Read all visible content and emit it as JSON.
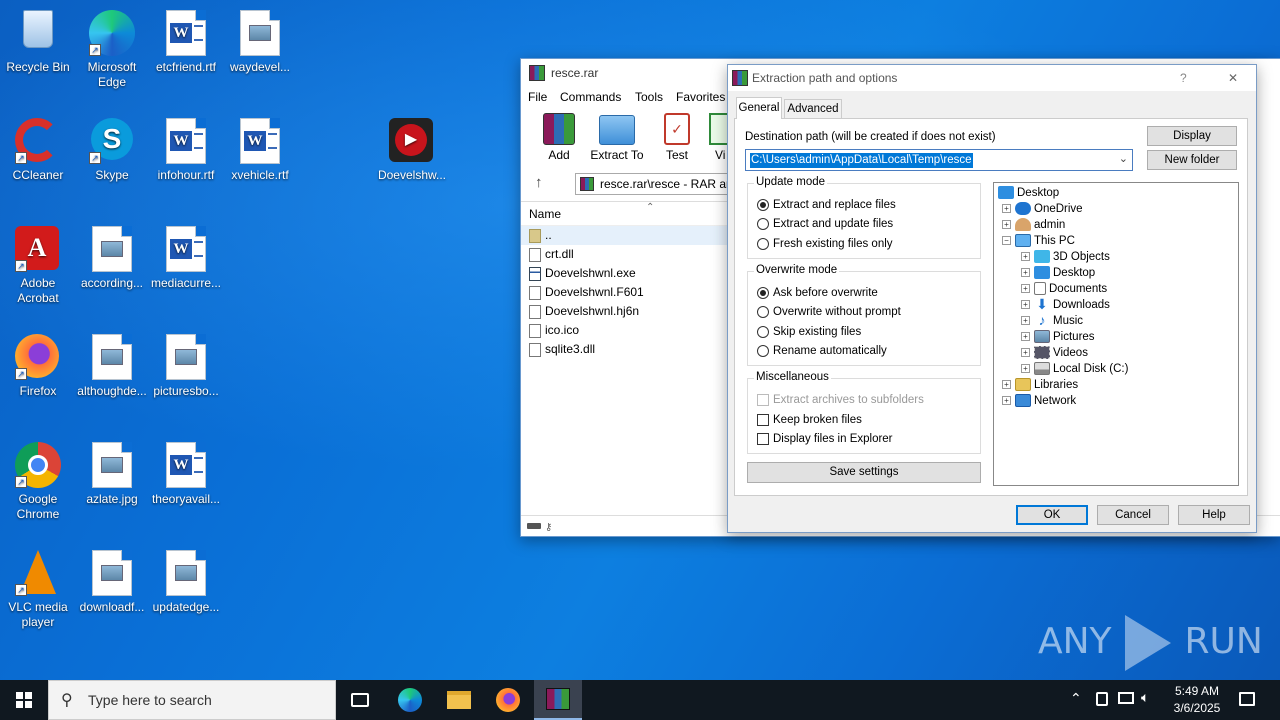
{
  "desktop": {
    "icons": [
      {
        "label": "Recycle Bin",
        "icon": "recycle-bin-icon"
      },
      {
        "label": "Microsoft Edge",
        "icon": "edge-icon"
      },
      {
        "label": "etcfriend.rtf",
        "icon": "word-doc-icon"
      },
      {
        "label": "waydevel...",
        "icon": "image-file-icon"
      },
      {
        "label": "CCleaner",
        "icon": "ccleaner-icon"
      },
      {
        "label": "Skype",
        "icon": "skype-icon"
      },
      {
        "label": "infohour.rtf",
        "icon": "word-doc-icon"
      },
      {
        "label": "xvehicle.rtf",
        "icon": "word-doc-icon"
      },
      {
        "label": "Doevelshw...",
        "icon": "media-player-icon"
      },
      {
        "label": "Adobe Acrobat",
        "icon": "acrobat-icon"
      },
      {
        "label": "according...",
        "icon": "image-file-icon"
      },
      {
        "label": "mediacurre...",
        "icon": "word-doc-icon"
      },
      {
        "label": "Firefox",
        "icon": "firefox-icon"
      },
      {
        "label": "althoughde...",
        "icon": "image-file-icon"
      },
      {
        "label": "picturesbo...",
        "icon": "image-file-icon"
      },
      {
        "label": "Google Chrome",
        "icon": "chrome-icon"
      },
      {
        "label": "azlate.jpg",
        "icon": "image-file-icon"
      },
      {
        "label": "theoryavail...",
        "icon": "word-doc-icon"
      },
      {
        "label": "VLC media player",
        "icon": "vlc-icon"
      },
      {
        "label": "downloadf...",
        "icon": "image-file-icon"
      },
      {
        "label": "updatedge...",
        "icon": "image-file-icon"
      }
    ]
  },
  "winrar": {
    "title": "resce.rar",
    "menu": [
      "File",
      "Commands",
      "Tools",
      "Favorites"
    ],
    "toolbar": [
      "Add",
      "Extract To",
      "Test",
      "Vi"
    ],
    "path": "resce.rar\\resce - RAR arc",
    "column_name": "Name",
    "files": [
      "..",
      "crt.dll",
      "Doevelshwnl.exe",
      "Doevelshwnl.F601",
      "Doevelshwnl.hj6n",
      "ico.ico",
      "sqlite3.dll"
    ]
  },
  "dialog": {
    "title": "Extraction path and options",
    "help_glyph": "?",
    "close_glyph": "✕",
    "tabs": [
      "General",
      "Advanced"
    ],
    "dest_label": "Destination path (will be created if does not exist)",
    "dest_value": "C:\\Users\\admin\\AppData\\Local\\Temp\\resce",
    "display_btn": "Display",
    "new_folder_btn": "New folder",
    "update_mode": {
      "title": "Update mode",
      "options": [
        "Extract and replace files",
        "Extract and update files",
        "Fresh existing files only"
      ],
      "selected": 0
    },
    "overwrite_mode": {
      "title": "Overwrite mode",
      "options": [
        "Ask before overwrite",
        "Overwrite without prompt",
        "Skip existing files",
        "Rename automatically"
      ],
      "selected": 0
    },
    "misc": {
      "title": "Miscellaneous",
      "options": [
        "Extract archives to subfolders",
        "Keep broken files",
        "Display files in Explorer"
      ]
    },
    "save_settings": "Save settings",
    "tree": [
      {
        "label": "Desktop",
        "level": 0,
        "exp": ""
      },
      {
        "label": "OneDrive",
        "level": 1,
        "exp": "+"
      },
      {
        "label": "admin",
        "level": 1,
        "exp": "+"
      },
      {
        "label": "This PC",
        "level": 1,
        "exp": "−"
      },
      {
        "label": "3D Objects",
        "level": 2,
        "exp": "+"
      },
      {
        "label": "Desktop",
        "level": 2,
        "exp": "+"
      },
      {
        "label": "Documents",
        "level": 2,
        "exp": "+"
      },
      {
        "label": "Downloads",
        "level": 2,
        "exp": "+"
      },
      {
        "label": "Music",
        "level": 2,
        "exp": "+"
      },
      {
        "label": "Pictures",
        "level": 2,
        "exp": "+"
      },
      {
        "label": "Videos",
        "level": 2,
        "exp": "+"
      },
      {
        "label": "Local Disk (C:)",
        "level": 2,
        "exp": "+"
      },
      {
        "label": "Libraries",
        "level": 1,
        "exp": "+"
      },
      {
        "label": "Network",
        "level": 1,
        "exp": "+"
      }
    ],
    "ok": "OK",
    "cancel": "Cancel",
    "help": "Help"
  },
  "taskbar": {
    "search_placeholder": "Type here to search",
    "time": "5:49 AM",
    "date": "3/6/2025"
  },
  "watermark": {
    "left": "ANY",
    "right": "RUN"
  }
}
